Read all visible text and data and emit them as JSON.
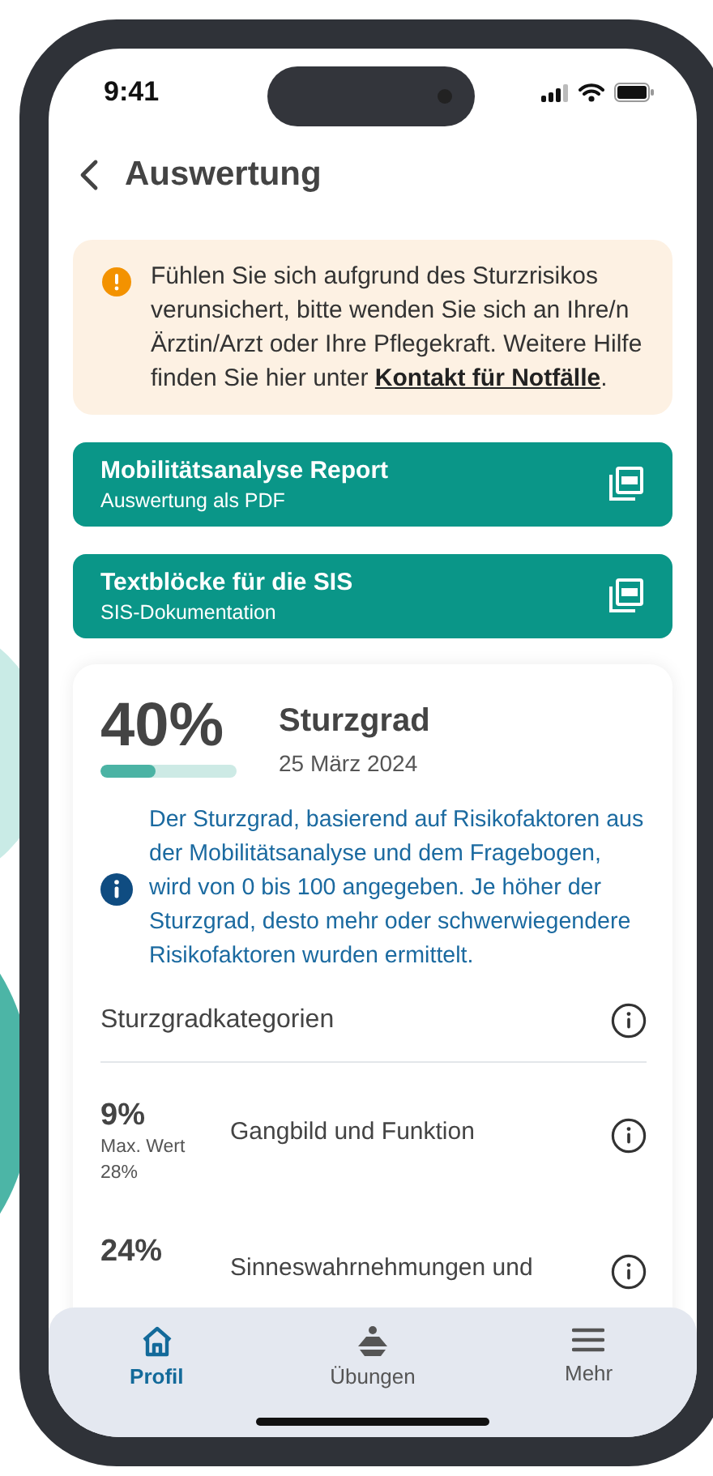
{
  "status_bar": {
    "time": "9:41"
  },
  "header": {
    "title": "Auswertung"
  },
  "alert": {
    "text": "Fühlen Sie sich aufgrund des Sturzrisikos verunsichert, bitte wenden Sie sich an Ihre/n Ärztin/Arzt oder Ihre Pflegekraft. Weitere Hilfe finden Sie hier unter ",
    "link": "Kontakt für Notfälle",
    "suffix": "."
  },
  "actions": [
    {
      "title": "Mobilitätsanalyse Report",
      "subtitle": "Auswertung als PDF"
    },
    {
      "title": "Textblöcke für die SIS",
      "subtitle": "SIS-Dokumentation"
    }
  ],
  "score": {
    "value": "40%",
    "level": 0.4,
    "title": "Sturzgrad",
    "date": "25 März 2024",
    "info": "Der Sturzgrad, basierend auf Risikofaktoren aus der Mobilitätsanalyse und dem Fragebogen, wird von 0 bis 100 angegeben. Je höher der Sturzgrad, desto mehr oder schwerwiegendere Risikofaktoren wurden ermittelt."
  },
  "categories": {
    "title": "Sturzgradkategorien",
    "items": [
      {
        "value": "9%",
        "max_label": "Max. Wert",
        "max_value": "28%",
        "name": "Gangbild und Funktion"
      },
      {
        "value": "24%",
        "name": "Sinneswahrnehmungen und"
      }
    ]
  },
  "tabs": [
    {
      "kind": "home",
      "label": "Profil",
      "selected": true
    },
    {
      "kind": "exercise",
      "label": "Übungen",
      "selected": false
    },
    {
      "kind": "menu",
      "label": "Mehr",
      "selected": false
    }
  ]
}
